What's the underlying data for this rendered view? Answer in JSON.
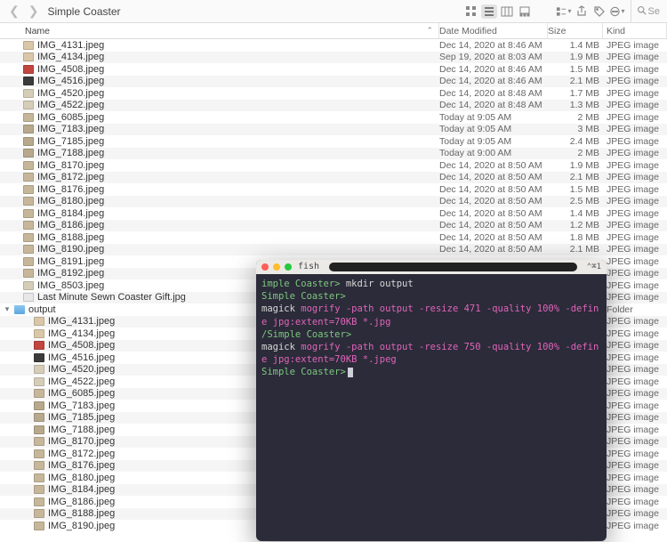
{
  "window": {
    "title": "Simple Coaster"
  },
  "search": {
    "placeholder": "Se"
  },
  "columns": {
    "name": "Name",
    "date": "Date Modified",
    "size": "Size",
    "kind": "Kind"
  },
  "kind_default": "JPEG image",
  "files": [
    {
      "name": "IMG_4131.jpeg",
      "date": "Dec 14, 2020 at 8:46 AM",
      "size": "1.4 MB",
      "thumb": "#d9c7a7"
    },
    {
      "name": "IMG_4134.jpeg",
      "date": "Sep 19, 2020 at 8:03 AM",
      "size": "1.9 MB",
      "thumb": "#d9c7a7"
    },
    {
      "name": "IMG_4508.jpeg",
      "date": "Dec 14, 2020 at 8:46 AM",
      "size": "1.5 MB",
      "thumb": "#c2453f"
    },
    {
      "name": "IMG_4516.jpeg",
      "date": "Dec 14, 2020 at 8:46 AM",
      "size": "2.1 MB",
      "thumb": "#3b3b3b"
    },
    {
      "name": "IMG_4520.jpeg",
      "date": "Dec 14, 2020 at 8:48 AM",
      "size": "1.7 MB",
      "thumb": "#d6cdb8"
    },
    {
      "name": "IMG_4522.jpeg",
      "date": "Dec 14, 2020 at 8:48 AM",
      "size": "1.3 MB",
      "thumb": "#d6cdb8"
    },
    {
      "name": "IMG_6085.jpeg",
      "date": "Today at 9:05 AM",
      "size": "2 MB",
      "thumb": "#c7b79a"
    },
    {
      "name": "IMG_7183.jpeg",
      "date": "Today at 9:05 AM",
      "size": "3 MB",
      "thumb": "#b8a98c"
    },
    {
      "name": "IMG_7185.jpeg",
      "date": "Today at 9:05 AM",
      "size": "2.4 MB",
      "thumb": "#b8a98c"
    },
    {
      "name": "IMG_7188.jpeg",
      "date": "Today at 9:00 AM",
      "size": "2 MB",
      "thumb": "#b8a98c"
    },
    {
      "name": "IMG_8170.jpeg",
      "date": "Dec 14, 2020 at 8:50 AM",
      "size": "1.9 MB",
      "thumb": "#c7b79a"
    },
    {
      "name": "IMG_8172.jpeg",
      "date": "Dec 14, 2020 at 8:50 AM",
      "size": "2.1 MB",
      "thumb": "#c7b79a"
    },
    {
      "name": "IMG_8176.jpeg",
      "date": "Dec 14, 2020 at 8:50 AM",
      "size": "1.5 MB",
      "thumb": "#c7b79a"
    },
    {
      "name": "IMG_8180.jpeg",
      "date": "Dec 14, 2020 at 8:50 AM",
      "size": "2.5 MB",
      "thumb": "#c7b79a"
    },
    {
      "name": "IMG_8184.jpeg",
      "date": "Dec 14, 2020 at 8:50 AM",
      "size": "1.4 MB",
      "thumb": "#c7b79a"
    },
    {
      "name": "IMG_8186.jpeg",
      "date": "Dec 14, 2020 at 8:50 AM",
      "size": "1.2 MB",
      "thumb": "#c7b79a"
    },
    {
      "name": "IMG_8188.jpeg",
      "date": "Dec 14, 2020 at 8:50 AM",
      "size": "1.8 MB",
      "thumb": "#c7b79a"
    },
    {
      "name": "IMG_8190.jpeg",
      "date": "Dec 14, 2020 at 8:50 AM",
      "size": "2.1 MB",
      "thumb": "#c7b79a"
    },
    {
      "name": "IMG_8191.jpeg",
      "date": "",
      "size": "",
      "thumb": "#c7b79a"
    },
    {
      "name": "IMG_8192.jpeg",
      "date": "",
      "size": "",
      "thumb": "#c7b79a"
    },
    {
      "name": "IMG_8503.jpeg",
      "date": "",
      "size": "",
      "thumb": "#d6cdb8"
    },
    {
      "name": "Last Minute Sewn Coaster Gift.jpg",
      "date": "",
      "size": "",
      "thumb": "#e8e8e8"
    },
    {
      "name": "output",
      "date": "",
      "size": "",
      "thumb": "folder",
      "kind": "Folder",
      "expandable": true,
      "expanded": true
    }
  ],
  "output_files": [
    {
      "name": "IMG_4131.jpeg",
      "thumb": "#d9c7a7"
    },
    {
      "name": "IMG_4134.jpeg",
      "thumb": "#d9c7a7"
    },
    {
      "name": "IMG_4508.jpeg",
      "thumb": "#c2453f"
    },
    {
      "name": "IMG_4516.jpeg",
      "thumb": "#3b3b3b"
    },
    {
      "name": "IMG_4520.jpeg",
      "thumb": "#d6cdb8"
    },
    {
      "name": "IMG_4522.jpeg",
      "thumb": "#d6cdb8"
    },
    {
      "name": "IMG_6085.jpeg",
      "thumb": "#c7b79a"
    },
    {
      "name": "IMG_7183.jpeg",
      "thumb": "#b8a98c"
    },
    {
      "name": "IMG_7185.jpeg",
      "thumb": "#b8a98c"
    },
    {
      "name": "IMG_7188.jpeg",
      "thumb": "#b8a98c"
    },
    {
      "name": "IMG_8170.jpeg",
      "thumb": "#c7b79a"
    },
    {
      "name": "IMG_8172.jpeg",
      "thumb": "#c7b79a"
    },
    {
      "name": "IMG_8176.jpeg",
      "thumb": "#c7b79a"
    },
    {
      "name": "IMG_8180.jpeg",
      "thumb": "#c7b79a"
    },
    {
      "name": "IMG_8184.jpeg",
      "thumb": "#c7b79a"
    },
    {
      "name": "IMG_8186.jpeg",
      "thumb": "#c7b79a"
    },
    {
      "name": "IMG_8188.jpeg",
      "thumb": "#c7b79a"
    },
    {
      "name": "IMG_8190.jpeg",
      "thumb": "#c7b79a"
    }
  ],
  "terminal": {
    "process": "fish",
    "shortcut": "⌃⌘1",
    "lines": [
      {
        "type": "prompt",
        "path": "imple Coaster>",
        "cmd": " mkdir output"
      },
      {
        "type": "prompt",
        "path": "Simple Coaster>",
        "cmd": ""
      },
      {
        "type": "cmd",
        "text": "magick ",
        "mag": "mogrify -path output -resize 471 -quality 100% -define jpg:extent=70KB *.jpg"
      },
      {
        "type": "prompt",
        "path": "/Simple Coaster>",
        "cmd": ""
      },
      {
        "type": "cmd",
        "text": "magick ",
        "mag": "mogrify -path output -resize 750 -quality 100% -define jpg:extent=70KB *.jpeg"
      },
      {
        "type": "prompt",
        "path": "Simple Coaster>",
        "cursor": true
      }
    ]
  }
}
